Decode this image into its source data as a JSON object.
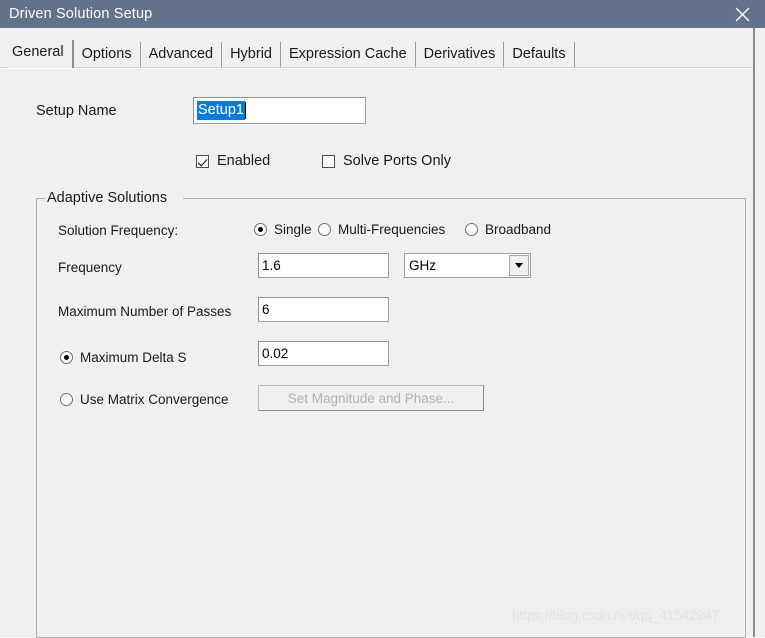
{
  "window": {
    "title": "Driven Solution Setup",
    "titlebar_color": "#63718a",
    "close_icon": "close-icon"
  },
  "tabs": [
    {
      "label": "General",
      "active": true
    },
    {
      "label": "Options",
      "active": false
    },
    {
      "label": "Advanced",
      "active": false
    },
    {
      "label": "Hybrid",
      "active": false
    },
    {
      "label": "Expression Cache",
      "active": false
    },
    {
      "label": "Derivatives",
      "active": false
    },
    {
      "label": "Defaults",
      "active": false
    }
  ],
  "general": {
    "setup_name_label": "Setup Name",
    "setup_name_value": "Setup1",
    "setup_name_selected": true,
    "selection_color": "#0a7bd4",
    "checkboxes": [
      {
        "label": "Enabled",
        "checked": true
      },
      {
        "label": "Solve Ports Only",
        "checked": false
      }
    ],
    "group": {
      "title": "Adaptive Solutions",
      "solution_frequency_label": "Solution Frequency:",
      "solution_frequency_options": [
        {
          "label": "Single",
          "selected": true
        },
        {
          "label": "Multi-Frequencies",
          "selected": false
        },
        {
          "label": "Broadband",
          "selected": false
        }
      ],
      "frequency_label": "Frequency",
      "frequency_value": "1.6",
      "frequency_unit": "GHz",
      "frequency_unit_icon": "chevron-down-icon",
      "max_passes_label": "Maximum Number of Passes",
      "max_passes_value": "6",
      "convergence_options": [
        {
          "label": "Maximum Delta S",
          "selected": true
        },
        {
          "label": "Use Matrix Convergence",
          "selected": false
        }
      ],
      "max_delta_s_value": "0.02",
      "set_magnitude_button": "Set Magnitude and Phase...",
      "set_magnitude_button_disabled": true
    }
  },
  "watermark": "https://blog.csdn.net/qq_41542947"
}
